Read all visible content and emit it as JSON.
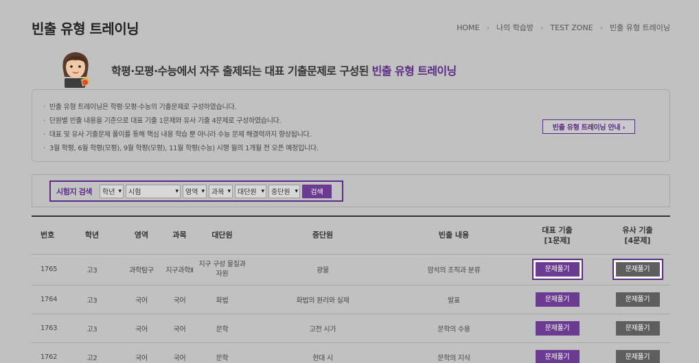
{
  "header": {
    "title": "빈출 유형 트레이닝",
    "breadcrumb": [
      "HOME",
      "나의 학습방",
      "TEST ZONE",
      "빈출 유형 트레이닝"
    ],
    "breadcrumb_separator": "›"
  },
  "intro": {
    "headline_main": "학평·모평·수능에서 자주 출제되는 대표 기출문제로 구성된 ",
    "headline_accent": "빈출 유형 트레이닝",
    "bullets": [
      "빈출 유형 트레이닝은 학평·모평·수능의 기출문제로 구성하였습니다.",
      "단원별 빈출 내용을 기준으로 대표 기출 1문제와 유사 기출 4문제로 구성하였습니다.",
      "대표 및 유사 기출문제 풀이를 통해 핵심 내용 학습 뿐 아니라 수능 문제 해결력까지 향상됩니다.",
      "3월 학평, 6월 학평(모평), 9월 학평(모평), 11월 학평(수능) 시행 월의 1개월 전 오픈 예정입니다."
    ],
    "guide_button": "빈출 유형 트레이닝 안내 ›"
  },
  "search": {
    "label": "시험지 검색",
    "selects": {
      "grade": "학년",
      "exam": "시험",
      "area": "영역",
      "subject": "과목",
      "major_unit": "대단원",
      "middle_unit": "중단원"
    },
    "button": "검색"
  },
  "table": {
    "headers": {
      "no": "번호",
      "grade": "학년",
      "area": "영역",
      "subject": "과목",
      "major_unit": "대단원",
      "middle_unit": "중단원",
      "content": "빈출 내용",
      "rep_line1": "대표 기출",
      "rep_line2": "[1문제]",
      "sim_line1": "유사 기출",
      "sim_line2": "[4문제]"
    },
    "solve_label": "문제풀기",
    "rows": [
      {
        "no": "1765",
        "grade": "고3",
        "area": "과학탐구",
        "subject": "지구과학Ⅱ",
        "major_unit": "지구 구성 물질과 자원",
        "middle_unit": "광물",
        "content": "암석의 조직과 분류"
      },
      {
        "no": "1764",
        "grade": "고3",
        "area": "국어",
        "subject": "국어",
        "major_unit": "화법",
        "middle_unit": "화법의 원리와 실제",
        "content": "발표"
      },
      {
        "no": "1763",
        "grade": "고3",
        "area": "국어",
        "subject": "국어",
        "major_unit": "문학",
        "middle_unit": "고전 시가",
        "content": "문학의 수용"
      },
      {
        "no": "1762",
        "grade": "고2",
        "area": "국어",
        "subject": "국어",
        "major_unit": "문학",
        "middle_unit": "현대 시",
        "content": "문학의 지식"
      }
    ]
  },
  "colors": {
    "background": "#c1c1c1",
    "accent_purple": "#5b2a86",
    "button_purple": "#6a3b91",
    "button_gray": "#5e5e5e"
  }
}
